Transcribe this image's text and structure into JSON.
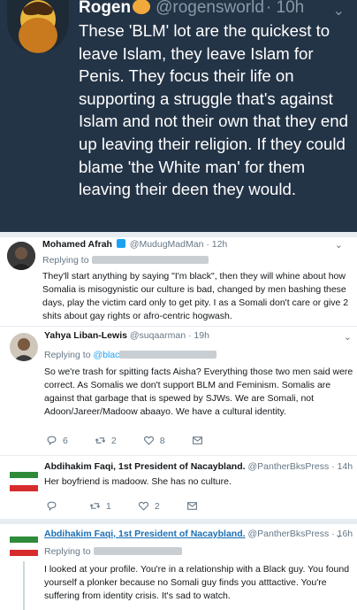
{
  "main_tweet": {
    "name": "Rogen",
    "handle": "@rogensworld",
    "time": "· 10h",
    "text": "These 'BLM' lot are the quickest to leave Islam, they leave Islam for Penis. They focus their life on supporting a struggle that's against Islam and not their own that they end up leaving their religion. If they could blame 'the White man' for them leaving their deen they would."
  },
  "tweets": [
    {
      "name": "Mohamed Afrah",
      "handle": "@MudugMadMan",
      "time": "· 12h",
      "replying_to": "Replying to",
      "text": "They'll start anything by saying \"I'm black\", then they will whine about how Somalia is misogynistic our culture is bad, changed by men bashing these days, play the victim card only to get pity. I as a Somali don't care or give 2 shits about gay rights or afro-centric hogwash."
    },
    {
      "name": "Yahya Liban-Lewis",
      "handle": "@suqaarman",
      "time": "· 19h",
      "replying_to": "Replying to",
      "replying_handle": "@blac",
      "text": "So we're trash for spitting facts Aisha? Everything those two men said were correct. As Somalis we don't support BLM and Feminism. Somalis are against that garbage that is spewed by SJWs. We are Somali, not Adoon/Jareer/Madoow abaayo. We have a cultural identity.",
      "replies": "6",
      "retweets": "2",
      "likes": "8"
    },
    {
      "name": "Abdihakim Faqi, 1st President of Nacaybland.",
      "handle": "@PantherBksPress",
      "time": "· 14h",
      "text": "Her boyfriend is madoow. She has no culture.",
      "replies": "",
      "retweets": "1",
      "likes": "2"
    },
    {
      "name": "Abdihakim Faqi, 1st President of Nacaybland.",
      "handle": "@PantherBksPress",
      "time": "· 16h",
      "replying_to": "Replying to",
      "text": "I looked at your profile. You're in a relationship with a Black guy. You found yourself a plonker because no Somali guy finds you atttactive. You're suffering from identity crisis. It's sad to watch."
    }
  ],
  "colors": {
    "dark_bg": "#243447",
    "muted": "#657786",
    "link": "#1da1f2",
    "flag_green": "#2e8b3a",
    "flag_red": "#d62c2c"
  },
  "icons": [
    "chevron-down-icon",
    "verified-badge-icon",
    "reply-icon",
    "retweet-icon",
    "like-icon",
    "dm-icon"
  ]
}
